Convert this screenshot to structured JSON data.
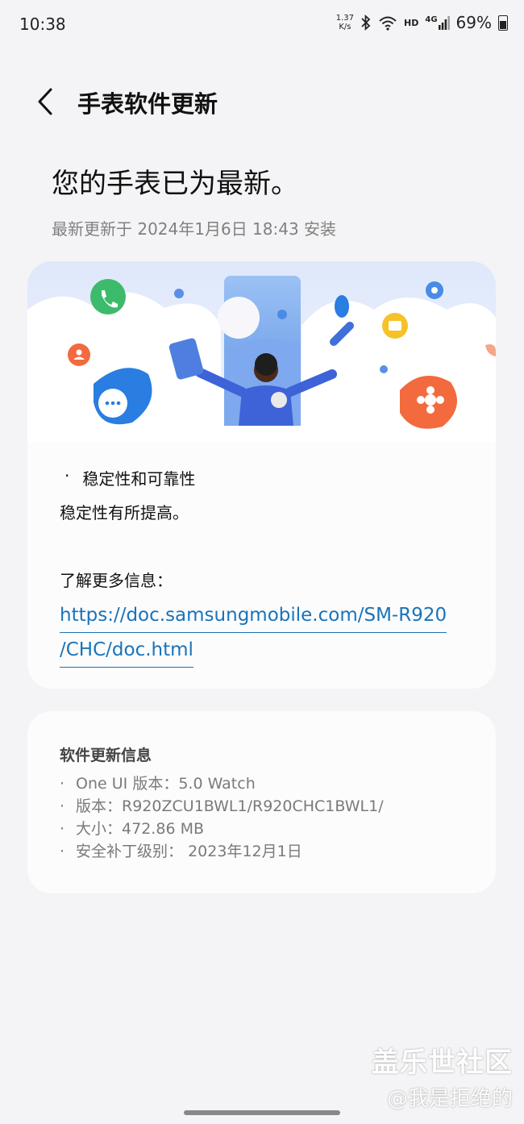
{
  "status_bar": {
    "time": "10:38",
    "net_speed_value": "1.37",
    "net_speed_unit": "K/s",
    "hd_label": "HD",
    "signal_label": "4G",
    "battery": "69%"
  },
  "header": {
    "back_icon": "chevron-left-icon",
    "title": "手表软件更新"
  },
  "headline": "您的手表已为最新。",
  "install_info": "最新更新于 2024年1月6日 18:43 安装",
  "release_notes": {
    "heading": "稳定性和可靠性",
    "body": "稳定性有所提高。",
    "more_info_label": "了解更多信息：",
    "link_line1": "https://doc.samsungmobile.com/SM-R920",
    "link_line2": "/CHC/doc.html"
  },
  "software_info": {
    "title": "软件更新信息",
    "items": [
      "One UI 版本：5.0 Watch",
      "版本：R920ZCU1BWL1/R920CHC1BWL1/",
      "大小：472.86 MB",
      "安全补丁级别：  2023年12月1日"
    ]
  },
  "watermark": {
    "line1": "盖乐世社区",
    "line2": "@我是拒绝的"
  },
  "colors": {
    "link": "#1a73b8",
    "background": "#f4f4f6",
    "card": "#fcfcfd",
    "accent_green": "#3dbb6c",
    "accent_orange": "#f26a3d",
    "accent_blue": "#2a7de1"
  }
}
